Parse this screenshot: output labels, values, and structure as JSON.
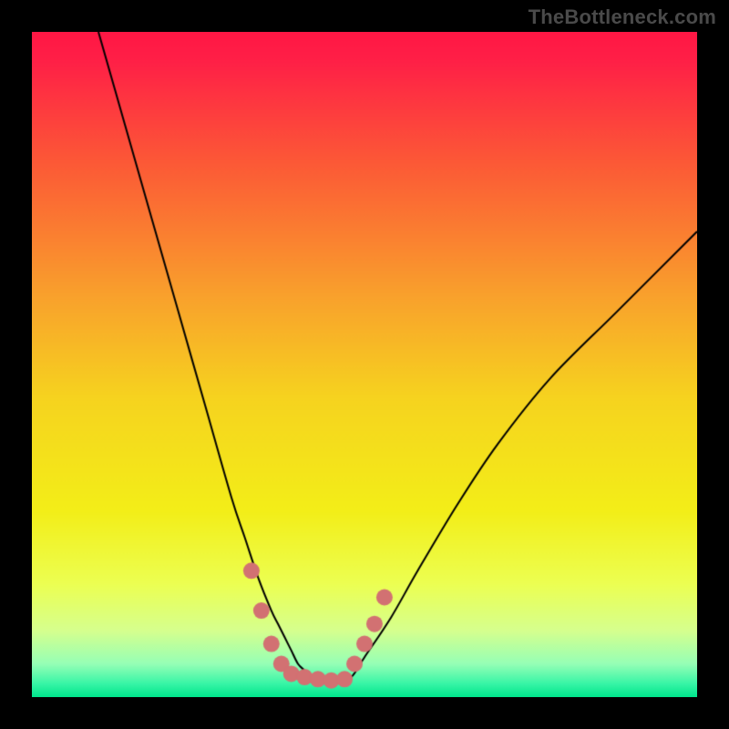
{
  "watermark": "TheBottleneck.com",
  "chart_data": {
    "type": "line",
    "title": "",
    "xlabel": "",
    "ylabel": "",
    "xlim": [
      0,
      100
    ],
    "ylim": [
      0,
      100
    ],
    "gradient_stops": [
      {
        "pos": 0.0,
        "color": "#ff1744"
      },
      {
        "pos": 0.04,
        "color": "#ff1f47"
      },
      {
        "pos": 0.2,
        "color": "#fc5a36"
      },
      {
        "pos": 0.4,
        "color": "#f9a22c"
      },
      {
        "pos": 0.55,
        "color": "#f6d31f"
      },
      {
        "pos": 0.72,
        "color": "#f3ee18"
      },
      {
        "pos": 0.83,
        "color": "#ecff52"
      },
      {
        "pos": 0.9,
        "color": "#d6ff8e"
      },
      {
        "pos": 0.95,
        "color": "#96ffb6"
      },
      {
        "pos": 0.98,
        "color": "#37f5a6"
      },
      {
        "pos": 1.0,
        "color": "#00e58c"
      }
    ],
    "curve": {
      "x": [
        10,
        14,
        18,
        22,
        26,
        30,
        32,
        34,
        36,
        37,
        38,
        39,
        40,
        41,
        42,
        43,
        44,
        46,
        48,
        50,
        54,
        58,
        64,
        70,
        78,
        88,
        100
      ],
      "y": [
        100,
        86,
        72,
        58,
        44,
        30,
        24,
        18,
        13,
        11,
        9,
        7,
        5,
        4,
        3,
        3,
        2.5,
        2.5,
        3,
        6,
        12,
        19,
        29,
        38,
        48,
        58,
        70
      ]
    },
    "markers": {
      "color": "#d27172",
      "radius": 9,
      "points": [
        {
          "x": 33,
          "y": 19
        },
        {
          "x": 34.5,
          "y": 13
        },
        {
          "x": 36,
          "y": 8
        },
        {
          "x": 37.5,
          "y": 5
        },
        {
          "x": 39,
          "y": 3.5
        },
        {
          "x": 41,
          "y": 3
        },
        {
          "x": 43,
          "y": 2.7
        },
        {
          "x": 45,
          "y": 2.5
        },
        {
          "x": 47,
          "y": 2.7
        },
        {
          "x": 48.5,
          "y": 5
        },
        {
          "x": 50,
          "y": 8
        },
        {
          "x": 51.5,
          "y": 11
        },
        {
          "x": 53,
          "y": 15
        }
      ]
    }
  }
}
